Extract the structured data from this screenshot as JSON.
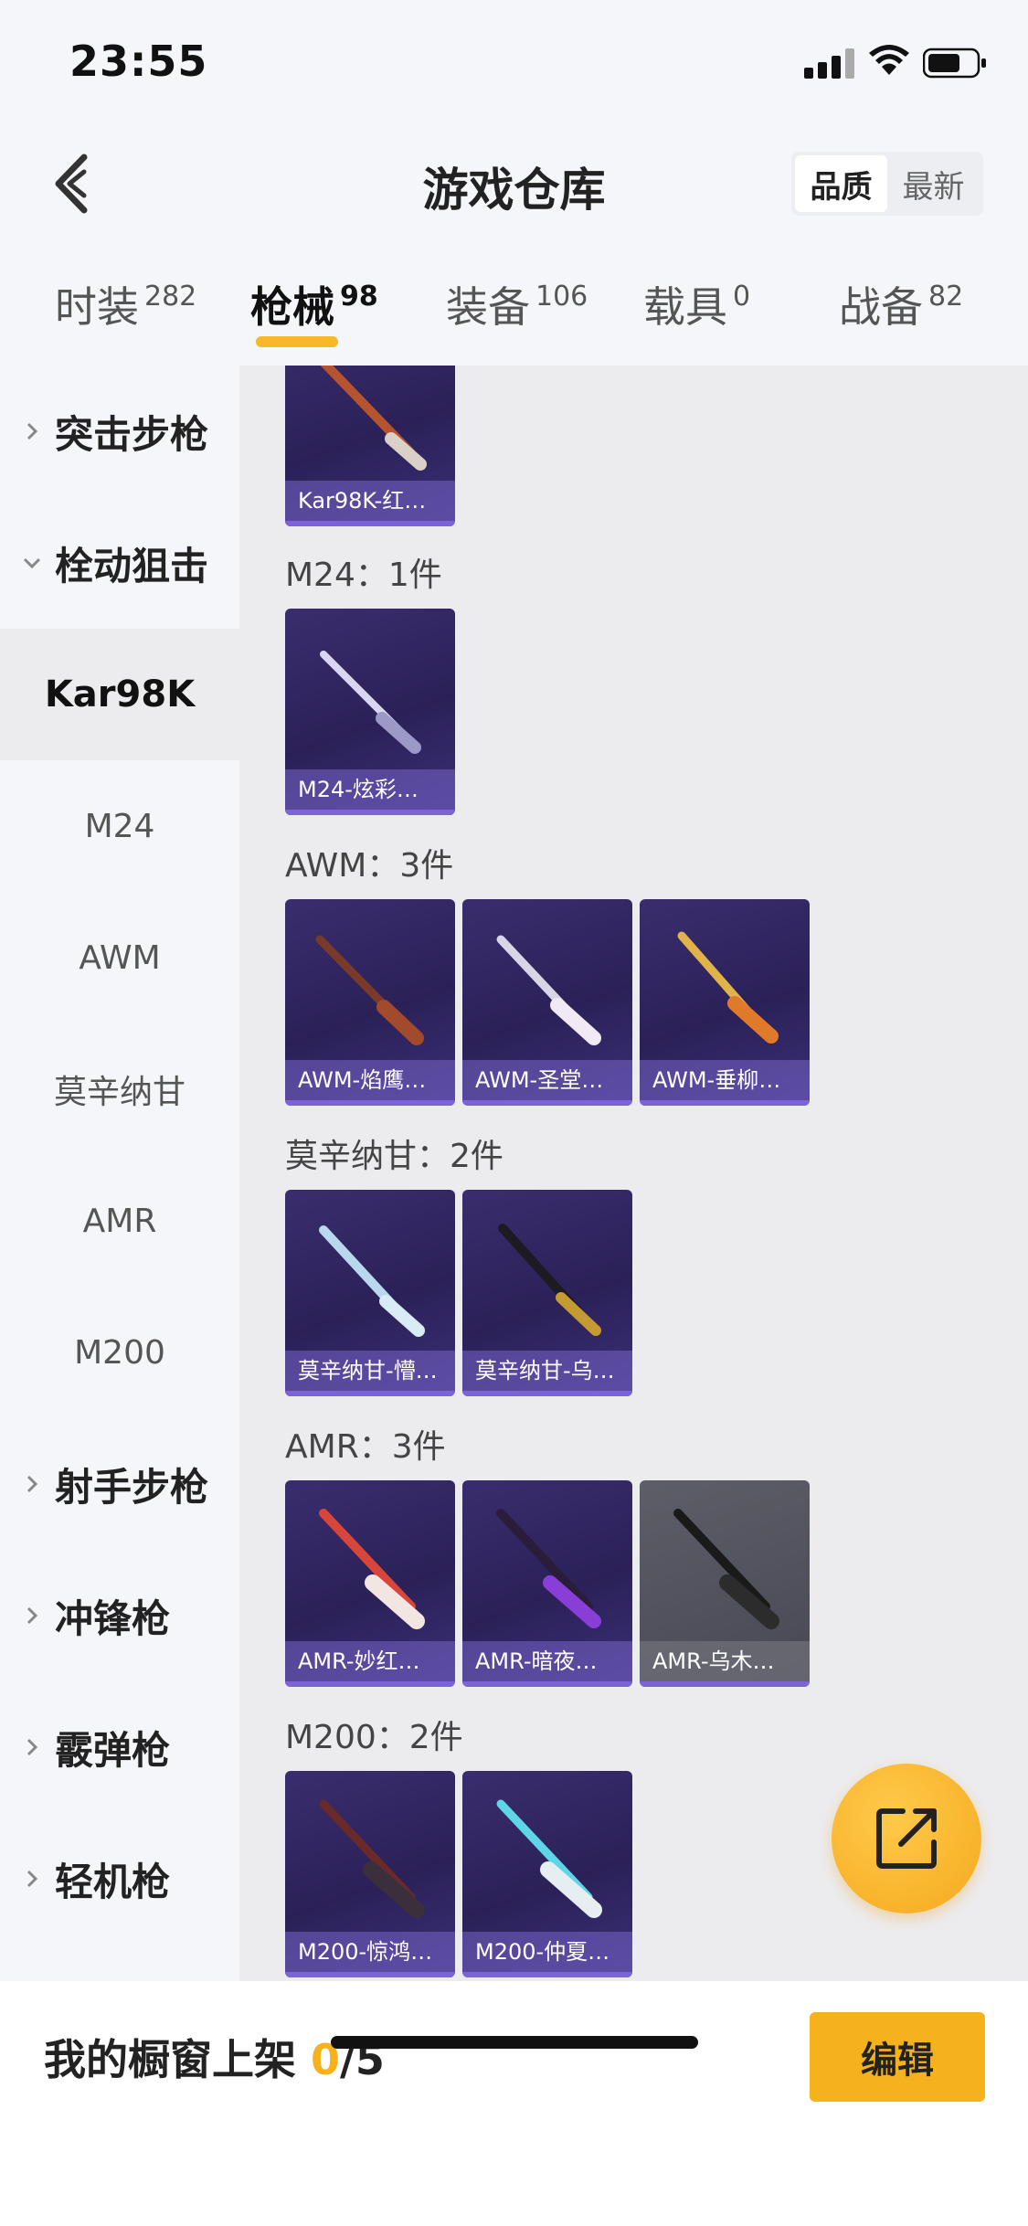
{
  "status_bar": {
    "time": "23:55"
  },
  "header": {
    "title": "游戏仓库",
    "sort_options": [
      "品质",
      "最新"
    ]
  },
  "category_tabs": [
    {
      "label": "时装",
      "count": "282"
    },
    {
      "label": "枪械",
      "count": "98"
    },
    {
      "label": "装备",
      "count": "106"
    },
    {
      "label": "载具",
      "count": "0"
    },
    {
      "label": "战备",
      "count": "82"
    }
  ],
  "sidebar": {
    "groups": [
      "突击步枪",
      "栓动狙击",
      "射手步枪",
      "冲锋枪",
      "霰弹枪",
      "轻机枪"
    ],
    "subitems": [
      "Kar98K",
      "M24",
      "AWM",
      "莫辛纳甘",
      "AMR",
      "M200"
    ]
  },
  "content": {
    "top_card": "Kar98K-红…",
    "sections": [
      {
        "title": "M24：1件",
        "items": [
          "M24-炫彩…"
        ]
      },
      {
        "title": "AWM：3件",
        "items": [
          "AWM-焰鹰…",
          "AWM-圣堂…",
          "AWM-垂柳…"
        ]
      },
      {
        "title": "莫辛纳甘：2件",
        "items": [
          "莫辛纳甘-懵…",
          "莫辛纳甘-乌…"
        ]
      },
      {
        "title": "AMR：3件",
        "items": [
          "AMR-妙红…",
          "AMR-暗夜…",
          "AMR-乌木…"
        ]
      },
      {
        "title": "M200：2件",
        "items": [
          "M200-惊鸿…",
          "M200-仲夏…"
        ]
      }
    ]
  },
  "bottom_bar": {
    "label": "我的橱窗上架",
    "count_current": "0",
    "count_total": "/5",
    "edit_label": "编辑"
  },
  "colors": {
    "accent": "#f5b21c",
    "card_purple": "#2b2158",
    "card_grey": "#474853"
  }
}
